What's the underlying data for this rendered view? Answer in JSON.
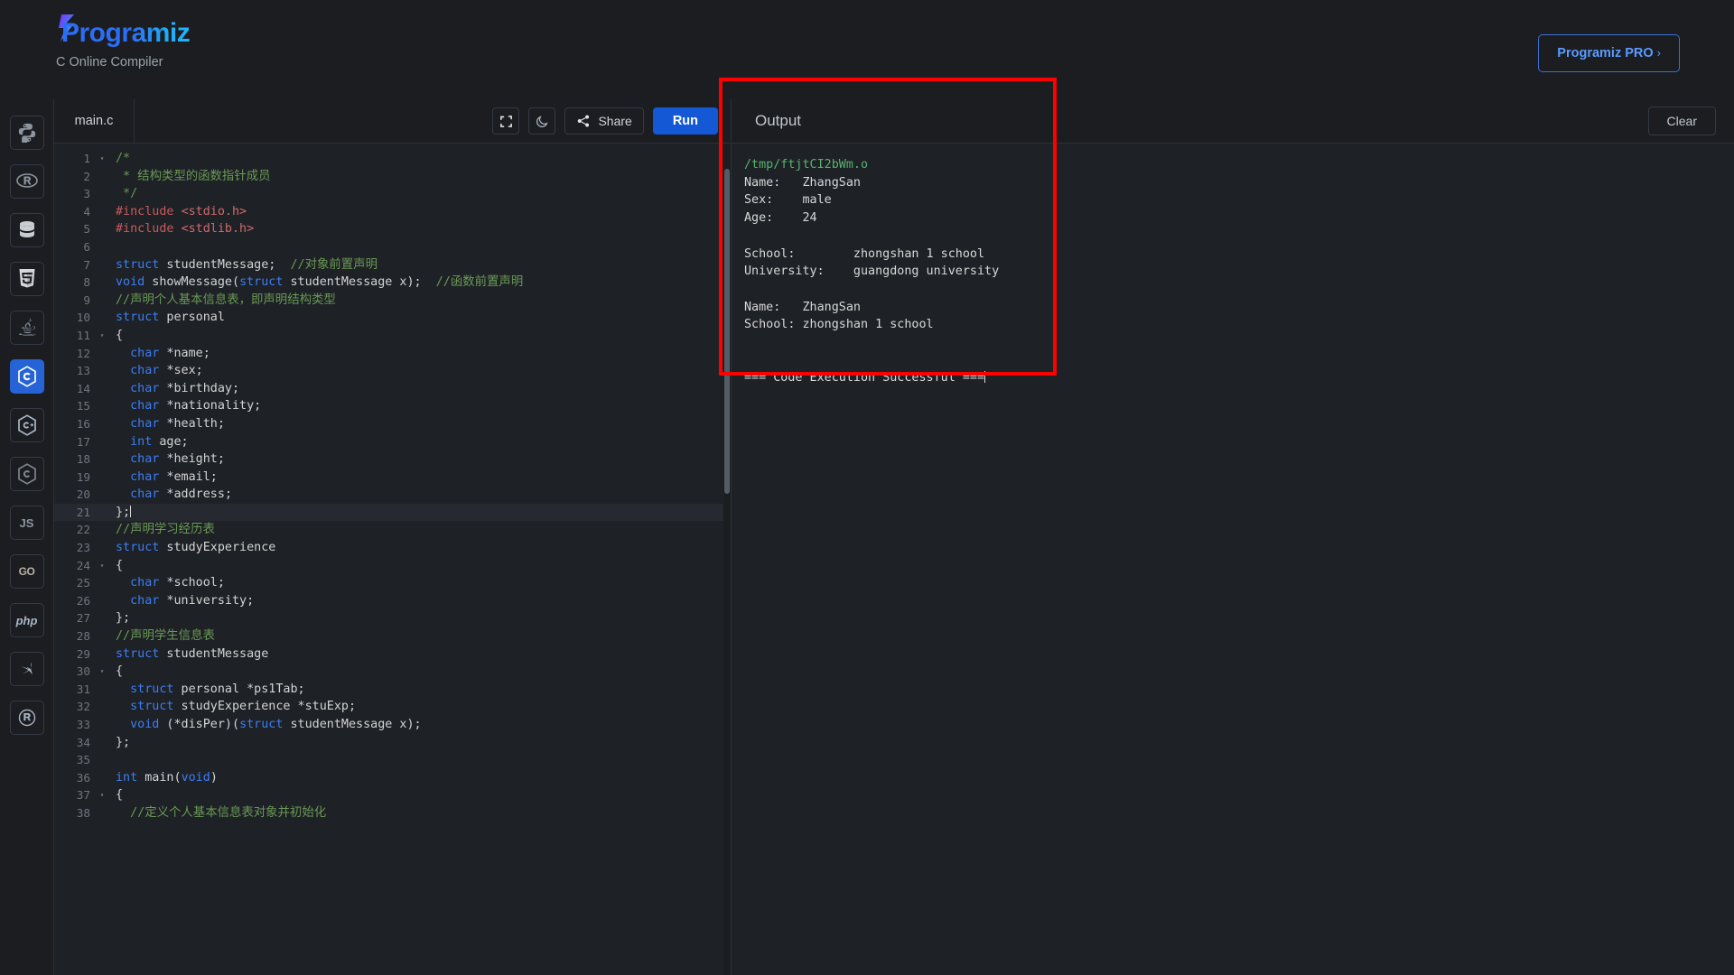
{
  "header": {
    "brand_name": "Programiz",
    "subtitle": "C Online Compiler",
    "pro_label": "Programiz PRO",
    "pro_chevron": "›"
  },
  "sidebar": {
    "items": [
      {
        "name": "python",
        "label": "",
        "icon": "python-icon",
        "active": false
      },
      {
        "name": "r",
        "label": "",
        "icon": "r-lang-icon",
        "active": false
      },
      {
        "name": "sql",
        "label": "",
        "icon": "database-icon",
        "active": false
      },
      {
        "name": "html",
        "label": "",
        "icon": "html5-icon",
        "active": false
      },
      {
        "name": "java",
        "label": "",
        "icon": "java-icon",
        "active": false
      },
      {
        "name": "c",
        "label": "",
        "icon": "c-lang-icon",
        "active": true
      },
      {
        "name": "cpp",
        "label": "",
        "icon": "cpp-lang-icon",
        "active": false
      },
      {
        "name": "csharp",
        "label": "",
        "icon": "csharp-lang-icon",
        "active": false
      },
      {
        "name": "javascript",
        "label": "JS",
        "icon": "js-icon",
        "active": false
      },
      {
        "name": "go",
        "label": "GO",
        "icon": "go-icon",
        "active": false
      },
      {
        "name": "php",
        "label": "php",
        "icon": "php-icon",
        "active": false
      },
      {
        "name": "swift",
        "label": "",
        "icon": "swift-icon",
        "active": false
      },
      {
        "name": "rust",
        "label": "",
        "icon": "rust-icon",
        "active": false
      }
    ]
  },
  "editor": {
    "filename": "main.c",
    "fullscreen_icon": "fullscreen-icon",
    "theme_icon": "moon-icon",
    "share_icon": "share-icon",
    "share_label": "Share",
    "run_label": "Run",
    "active_line": 21,
    "lines": [
      {
        "n": 1,
        "fold": "▾",
        "tokens": [
          {
            "t": "cmt",
            "v": "/*"
          }
        ]
      },
      {
        "n": 2,
        "fold": "",
        "tokens": [
          {
            "t": "cmt",
            "v": " * 结构类型的函数指针成员"
          }
        ]
      },
      {
        "n": 3,
        "fold": "",
        "tokens": [
          {
            "t": "cmt",
            "v": " */"
          }
        ]
      },
      {
        "n": 4,
        "fold": "",
        "tokens": [
          {
            "t": "pp",
            "v": "#include "
          },
          {
            "t": "str",
            "v": "<stdio.h>"
          }
        ]
      },
      {
        "n": 5,
        "fold": "",
        "tokens": [
          {
            "t": "pp",
            "v": "#include "
          },
          {
            "t": "str",
            "v": "<stdlib.h>"
          }
        ]
      },
      {
        "n": 6,
        "fold": "",
        "tokens": []
      },
      {
        "n": 7,
        "fold": "",
        "tokens": [
          {
            "t": "k",
            "v": "struct"
          },
          {
            "t": "pun",
            "v": " studentMessage;  "
          },
          {
            "t": "cmt",
            "v": "//对象前置声明"
          }
        ]
      },
      {
        "n": 8,
        "fold": "",
        "tokens": [
          {
            "t": "k",
            "v": "void"
          },
          {
            "t": "pun",
            "v": " showMessage("
          },
          {
            "t": "k",
            "v": "struct"
          },
          {
            "t": "pun",
            "v": " studentMessage x);  "
          },
          {
            "t": "cmt",
            "v": "//函数前置声明"
          }
        ]
      },
      {
        "n": 9,
        "fold": "",
        "tokens": [
          {
            "t": "cmt",
            "v": "//声明个人基本信息表，即声明结构类型"
          }
        ]
      },
      {
        "n": 10,
        "fold": "",
        "tokens": [
          {
            "t": "k",
            "v": "struct"
          },
          {
            "t": "pun",
            "v": " personal"
          }
        ]
      },
      {
        "n": 11,
        "fold": "▾",
        "tokens": [
          {
            "t": "pun",
            "v": "{"
          }
        ]
      },
      {
        "n": 12,
        "fold": "",
        "tokens": [
          {
            "t": "pun",
            "v": "  "
          },
          {
            "t": "k",
            "v": "char"
          },
          {
            "t": "pun",
            "v": " *name;"
          }
        ]
      },
      {
        "n": 13,
        "fold": "",
        "tokens": [
          {
            "t": "pun",
            "v": "  "
          },
          {
            "t": "k",
            "v": "char"
          },
          {
            "t": "pun",
            "v": " *sex;"
          }
        ]
      },
      {
        "n": 14,
        "fold": "",
        "tokens": [
          {
            "t": "pun",
            "v": "  "
          },
          {
            "t": "k",
            "v": "char"
          },
          {
            "t": "pun",
            "v": " *birthday;"
          }
        ]
      },
      {
        "n": 15,
        "fold": "",
        "tokens": [
          {
            "t": "pun",
            "v": "  "
          },
          {
            "t": "k",
            "v": "char"
          },
          {
            "t": "pun",
            "v": " *nationality;"
          }
        ]
      },
      {
        "n": 16,
        "fold": "",
        "tokens": [
          {
            "t": "pun",
            "v": "  "
          },
          {
            "t": "k",
            "v": "char"
          },
          {
            "t": "pun",
            "v": " *health;"
          }
        ]
      },
      {
        "n": 17,
        "fold": "",
        "tokens": [
          {
            "t": "pun",
            "v": "  "
          },
          {
            "t": "k",
            "v": "int"
          },
          {
            "t": "pun",
            "v": " age;"
          }
        ]
      },
      {
        "n": 18,
        "fold": "",
        "tokens": [
          {
            "t": "pun",
            "v": "  "
          },
          {
            "t": "k",
            "v": "char"
          },
          {
            "t": "pun",
            "v": " *height;"
          }
        ]
      },
      {
        "n": 19,
        "fold": "",
        "tokens": [
          {
            "t": "pun",
            "v": "  "
          },
          {
            "t": "k",
            "v": "char"
          },
          {
            "t": "pun",
            "v": " *email;"
          }
        ]
      },
      {
        "n": 20,
        "fold": "",
        "tokens": [
          {
            "t": "pun",
            "v": "  "
          },
          {
            "t": "k",
            "v": "char"
          },
          {
            "t": "pun",
            "v": " *address;"
          }
        ]
      },
      {
        "n": 21,
        "fold": "",
        "tokens": [
          {
            "t": "pun",
            "v": "};"
          }
        ],
        "caret": true
      },
      {
        "n": 22,
        "fold": "",
        "tokens": [
          {
            "t": "cmt",
            "v": "//声明学习经历表"
          }
        ]
      },
      {
        "n": 23,
        "fold": "",
        "tokens": [
          {
            "t": "k",
            "v": "struct"
          },
          {
            "t": "pun",
            "v": " studyExperience"
          }
        ]
      },
      {
        "n": 24,
        "fold": "▾",
        "tokens": [
          {
            "t": "pun",
            "v": "{"
          }
        ]
      },
      {
        "n": 25,
        "fold": "",
        "tokens": [
          {
            "t": "pun",
            "v": "  "
          },
          {
            "t": "k",
            "v": "char"
          },
          {
            "t": "pun",
            "v": " *school;"
          }
        ]
      },
      {
        "n": 26,
        "fold": "",
        "tokens": [
          {
            "t": "pun",
            "v": "  "
          },
          {
            "t": "k",
            "v": "char"
          },
          {
            "t": "pun",
            "v": " *university;"
          }
        ]
      },
      {
        "n": 27,
        "fold": "",
        "tokens": [
          {
            "t": "pun",
            "v": "};"
          }
        ]
      },
      {
        "n": 28,
        "fold": "",
        "tokens": [
          {
            "t": "cmt",
            "v": "//声明学生信息表"
          }
        ]
      },
      {
        "n": 29,
        "fold": "",
        "tokens": [
          {
            "t": "k",
            "v": "struct"
          },
          {
            "t": "pun",
            "v": " studentMessage"
          }
        ]
      },
      {
        "n": 30,
        "fold": "▾",
        "tokens": [
          {
            "t": "pun",
            "v": "{"
          }
        ]
      },
      {
        "n": 31,
        "fold": "",
        "tokens": [
          {
            "t": "pun",
            "v": "  "
          },
          {
            "t": "k",
            "v": "struct"
          },
          {
            "t": "pun",
            "v": " personal *ps1Tab;"
          }
        ]
      },
      {
        "n": 32,
        "fold": "",
        "tokens": [
          {
            "t": "pun",
            "v": "  "
          },
          {
            "t": "k",
            "v": "struct"
          },
          {
            "t": "pun",
            "v": " studyExperience *stuExp;"
          }
        ]
      },
      {
        "n": 33,
        "fold": "",
        "tokens": [
          {
            "t": "pun",
            "v": "  "
          },
          {
            "t": "k",
            "v": "void"
          },
          {
            "t": "pun",
            "v": " (*disPer)("
          },
          {
            "t": "k",
            "v": "struct"
          },
          {
            "t": "pun",
            "v": " studentMessage x);"
          }
        ]
      },
      {
        "n": 34,
        "fold": "",
        "tokens": [
          {
            "t": "pun",
            "v": "};"
          }
        ]
      },
      {
        "n": 35,
        "fold": "",
        "tokens": []
      },
      {
        "n": 36,
        "fold": "",
        "tokens": [
          {
            "t": "k",
            "v": "int"
          },
          {
            "t": "pun",
            "v": " main("
          },
          {
            "t": "k",
            "v": "void"
          },
          {
            "t": "pun",
            "v": ")"
          }
        ]
      },
      {
        "n": 37,
        "fold": "▾",
        "tokens": [
          {
            "t": "pun",
            "v": "{"
          }
        ]
      },
      {
        "n": 38,
        "fold": "",
        "tokens": [
          {
            "t": "pun",
            "v": "  "
          },
          {
            "t": "cmt",
            "v": "//定义个人基本信息表对象并初始化"
          }
        ]
      }
    ]
  },
  "output": {
    "title": "Output",
    "clear_label": "Clear",
    "object_path": "/tmp/ftjtCI2bWm.o",
    "body_lines": [
      "Name:   ZhangSan",
      "Sex:    male",
      "Age:    24",
      "",
      "School:        zhongshan 1 school",
      "University:    guangdong university",
      "",
      "Name:   ZhangSan",
      "School: zhongshan 1 school",
      "",
      "",
      "=== Code Execution Successful ==="
    ]
  },
  "annotation": {
    "color": "#fe0000",
    "shape": "rectangle",
    "targets": "output-panel"
  }
}
